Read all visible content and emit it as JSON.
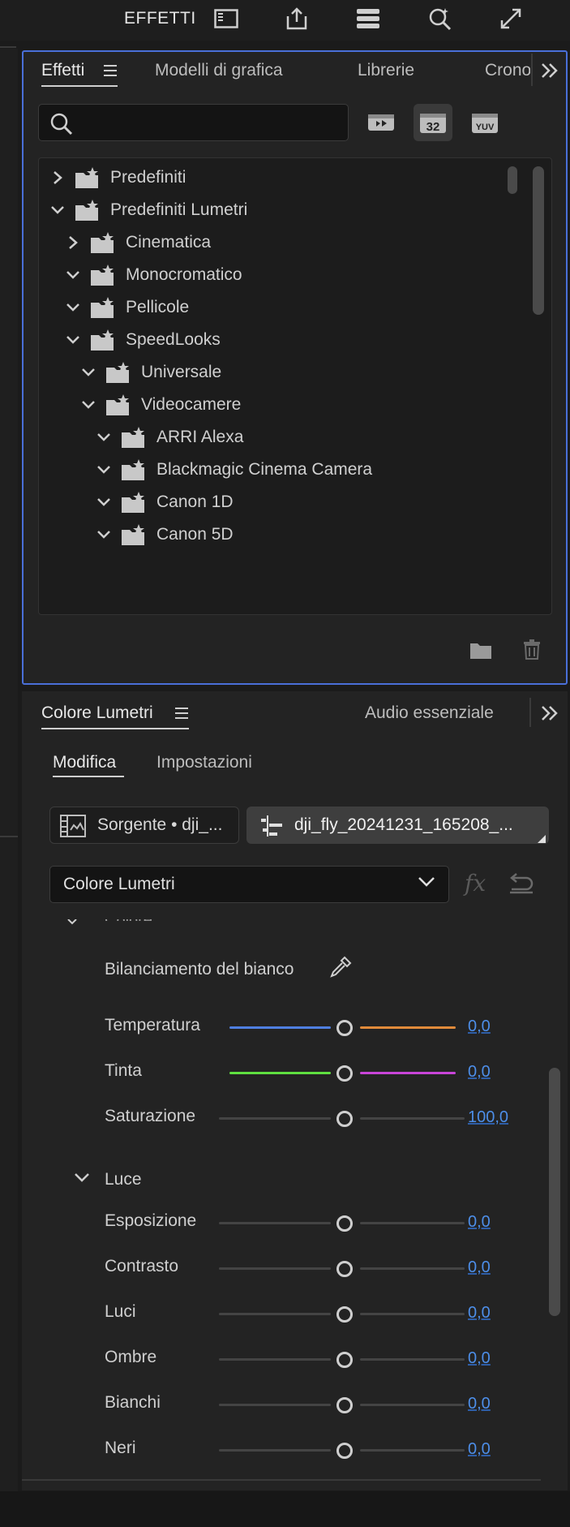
{
  "toolbar": {
    "title": "EFFETTI",
    "icons": [
      "sidebar-icon",
      "share-icon",
      "stack-icon",
      "magic-search-icon",
      "expand-icon"
    ]
  },
  "effects_panel": {
    "tabs": [
      {
        "label": "Effetti",
        "active": true
      },
      {
        "label": "Modelli di grafica",
        "active": false
      },
      {
        "label": "Librerie",
        "active": false
      },
      {
        "label": "Crono",
        "active": false
      }
    ],
    "search": {
      "value": "",
      "placeholder": ""
    },
    "filter_buttons": {
      "badge_32": "32",
      "badge_yuv": "YUV"
    },
    "tree": [
      {
        "label": "Predefiniti",
        "depth": 0,
        "expanded": false
      },
      {
        "label": "Predefiniti Lumetri",
        "depth": 0,
        "expanded": true
      },
      {
        "label": "Cinematica",
        "depth": 1,
        "expanded": false
      },
      {
        "label": "Monocromatico",
        "depth": 1,
        "expanded": true
      },
      {
        "label": "Pellicole",
        "depth": 1,
        "expanded": true
      },
      {
        "label": "SpeedLooks",
        "depth": 1,
        "expanded": true
      },
      {
        "label": "Universale",
        "depth": 2,
        "expanded": true
      },
      {
        "label": "Videocamere",
        "depth": 2,
        "expanded": true
      },
      {
        "label": "ARRI Alexa",
        "depth": 3,
        "expanded": true
      },
      {
        "label": "Blackmagic Cinema Camera",
        "depth": 3,
        "expanded": true
      },
      {
        "label": "Canon 1D",
        "depth": 3,
        "expanded": true
      },
      {
        "label": "Canon 5D",
        "depth": 3,
        "expanded": true
      }
    ]
  },
  "lumetri_panel": {
    "tabs": [
      {
        "label": "Colore Lumetri",
        "active": true
      },
      {
        "label": "Audio essenziale",
        "active": false
      }
    ],
    "subtabs": [
      {
        "label": "Modifica",
        "active": true
      },
      {
        "label": "Impostazioni",
        "active": false
      }
    ],
    "source_label": "Sorgente • dji_...",
    "clip_label": "dji_fly_20241231_165208_...",
    "effect_select": "Colore Lumetri",
    "fx_label": "fx",
    "white_balance_label": "Bilanciamento del bianco",
    "color_sliders": [
      {
        "label": "Temperatura",
        "value": "0,0",
        "left_color": "#4f7fe0",
        "right_color": "#e08a3a"
      },
      {
        "label": "Tinta",
        "value": "0,0",
        "left_color": "#5fe040",
        "right_color": "#c845d8"
      },
      {
        "label": "Saturazione",
        "value": "100,0",
        "left_color": "#444444",
        "right_color": "#444444"
      }
    ],
    "light_section": "Luce",
    "light_sliders": [
      {
        "label": "Esposizione",
        "value": "0,0"
      },
      {
        "label": "Contrasto",
        "value": "0,0"
      },
      {
        "label": "Luci",
        "value": "0,0"
      },
      {
        "label": "Ombre",
        "value": "0,0"
      },
      {
        "label": "Bianchi",
        "value": "0,0"
      },
      {
        "label": "Neri",
        "value": "0,0"
      }
    ]
  },
  "colors": {
    "accent": "#4a6fd8",
    "value_blue": "#4d8ee8"
  }
}
